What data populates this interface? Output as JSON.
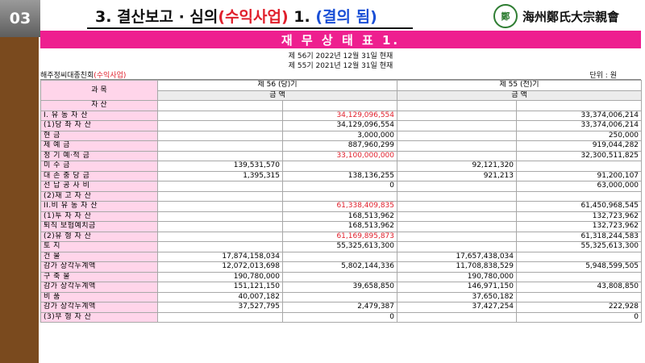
{
  "badge": "03",
  "title": {
    "part1": "3. 결산보고 · 심의",
    "part2": "(수익사업)",
    "part3": " 1. ",
    "part4": "(결의 됨)"
  },
  "logo": {
    "seal": "鄭",
    "org": "海州鄭氏大宗親會"
  },
  "banner": "재 무 상 태 표 1.",
  "periods": [
    "제 56기 2022년 12월 31일 현재",
    "제 55기 2021년 12월 31일 현재"
  ],
  "org_line": {
    "name": "해주정씨대종친회",
    "tag": "(수익사업)",
    "unit": "단위 : 원"
  },
  "table": {
    "head_subject": "과 목",
    "head_cur": "제 56 (당)기",
    "head_prev": "제 55 (전)기",
    "amount_cur": "금 액",
    "amount_prev": "금 액",
    "rows": [
      {
        "label": "자 산",
        "a": "",
        "b": "",
        "c": "",
        "d": "",
        "center": true
      },
      {
        "label": "I. 유 동 자 산",
        "a": "",
        "b": "34,129,096,554",
        "c": "",
        "d": "33,374,006,214",
        "red": true
      },
      {
        "label": "(1)당 좌 자 산",
        "a": "",
        "b": "34,129,096,554",
        "c": "",
        "d": "33,374,006,214"
      },
      {
        "label": "현 금",
        "a": "",
        "b": "3,000,000",
        "c": "",
        "d": "250,000"
      },
      {
        "label": "제 예 금",
        "a": "",
        "b": "887,960,299",
        "c": "",
        "d": "919,044,282"
      },
      {
        "label": "정 기 예·적 금",
        "a": "",
        "b": "33,100,000,000",
        "c": "",
        "d": "32,300,511,825",
        "red": true
      },
      {
        "label": "미 수 금",
        "a": "139,531,570",
        "b": "",
        "c": "92,121,320",
        "d": ""
      },
      {
        "label": "대 손 충 당 금",
        "a": "1,395,315",
        "b": "138,136,255",
        "c": "921,213",
        "d": "91,200,107"
      },
      {
        "label": "선 납 공 사 비",
        "a": "",
        "b": "0",
        "c": "",
        "d": "63,000,000"
      },
      {
        "label": "(2)재 고 자 산",
        "a": "",
        "b": "",
        "c": "",
        "d": ""
      },
      {
        "label": "II.비 유 동 자 산",
        "a": "",
        "b": "61,338,409,835",
        "c": "",
        "d": "61,450,968,545",
        "red": true
      },
      {
        "label": "(1)투 자 자 산",
        "a": "",
        "b": "168,513,962",
        "c": "",
        "d": "132,723,962"
      },
      {
        "label": "퇴직 보험예치금",
        "a": "",
        "b": "168,513,962",
        "c": "",
        "d": "132,723,962"
      },
      {
        "label": "(2)유 형 자 산",
        "a": "",
        "b": "61,169,895,873",
        "c": "",
        "d": "61,318,244,583",
        "red": true
      },
      {
        "label": "토 지",
        "a": "",
        "b": "55,325,613,300",
        "c": "",
        "d": "55,325,613,300"
      },
      {
        "label": "건 물",
        "a": "17,874,158,034",
        "b": "",
        "c": "17,657,438,034",
        "d": ""
      },
      {
        "label": "감가 상각누계액",
        "a": "12,072,013,698",
        "b": "5,802,144,336",
        "c": "11,708,838,529",
        "d": "5,948,599,505"
      },
      {
        "label": "구 축 물",
        "a": "190,780,000",
        "b": "",
        "c": "190,780,000",
        "d": ""
      },
      {
        "label": "감가 상각누계액",
        "a": "151,121,150",
        "b": "39,658,850",
        "c": "146,971,150",
        "d": "43,808,850"
      },
      {
        "label": "비 품",
        "a": "40,007,182",
        "b": "",
        "c": "37,650,182",
        "d": ""
      },
      {
        "label": "감가 상각누계액",
        "a": "37,527,795",
        "b": "2,479,387",
        "c": "37,427,254",
        "d": "222,928"
      },
      {
        "label": "(3)무 형 자 산",
        "a": "",
        "b": "0",
        "c": "",
        "d": "0"
      }
    ]
  },
  "colors": {
    "banner": "#ee1f8f",
    "label_bg": "#ffd5ea",
    "highlight": "#e0202c",
    "title_blue": "#1a4fd6",
    "sidebar": "#7a4a1e"
  }
}
